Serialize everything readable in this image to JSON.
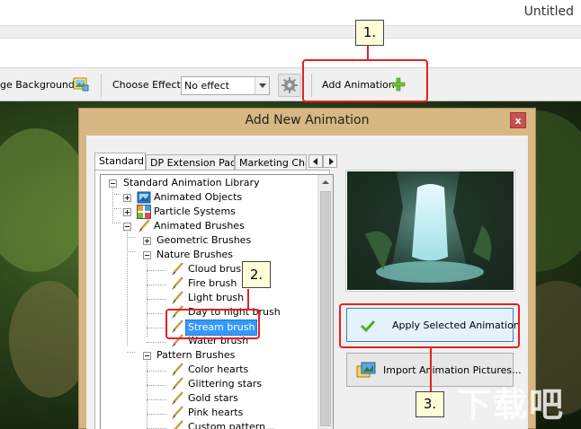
{
  "window": {
    "title": "Untitled"
  },
  "toolbar": {
    "background_label": "ge Background",
    "effect_label": "Choose Effect:",
    "effect_value": "No effect",
    "add_animation_label": "Add Animation"
  },
  "dialog": {
    "title": "Add New Animation",
    "close_glyph": "x",
    "tabs": [
      {
        "label": "Standard"
      },
      {
        "label": "DP Extension Pack"
      },
      {
        "label": "Marketing Char"
      }
    ],
    "tree": [
      {
        "label": "Standard Animation Library"
      },
      {
        "label": "Animated Objects"
      },
      {
        "label": "Particle Systems"
      },
      {
        "label": "Animated Brushes"
      },
      {
        "label": "Geometric Brushes"
      },
      {
        "label": "Nature Brushes"
      },
      {
        "label": "Cloud brush"
      },
      {
        "label": "Fire brush"
      },
      {
        "label": "Light brush"
      },
      {
        "label": "Day to night brush"
      },
      {
        "label": "Stream brush"
      },
      {
        "label": "Water brush"
      },
      {
        "label": "Pattern Brushes"
      },
      {
        "label": "Color hearts"
      },
      {
        "label": "Glittering stars"
      },
      {
        "label": "Gold stars"
      },
      {
        "label": "Pink hearts"
      },
      {
        "label": "Custom pattern..."
      }
    ],
    "apply_label": "Apply Selected Animation",
    "import_label": "Import Animation Pictures..."
  },
  "annotations": {
    "step1": "1.",
    "step2": "2.",
    "step3": "3."
  },
  "watermark": {
    "text": "下载吧"
  },
  "colors": {
    "callout": "#e52020",
    "selection": "#3399ff",
    "dialog_frame": "#d7b782",
    "apply_check": "#4caf2a"
  }
}
